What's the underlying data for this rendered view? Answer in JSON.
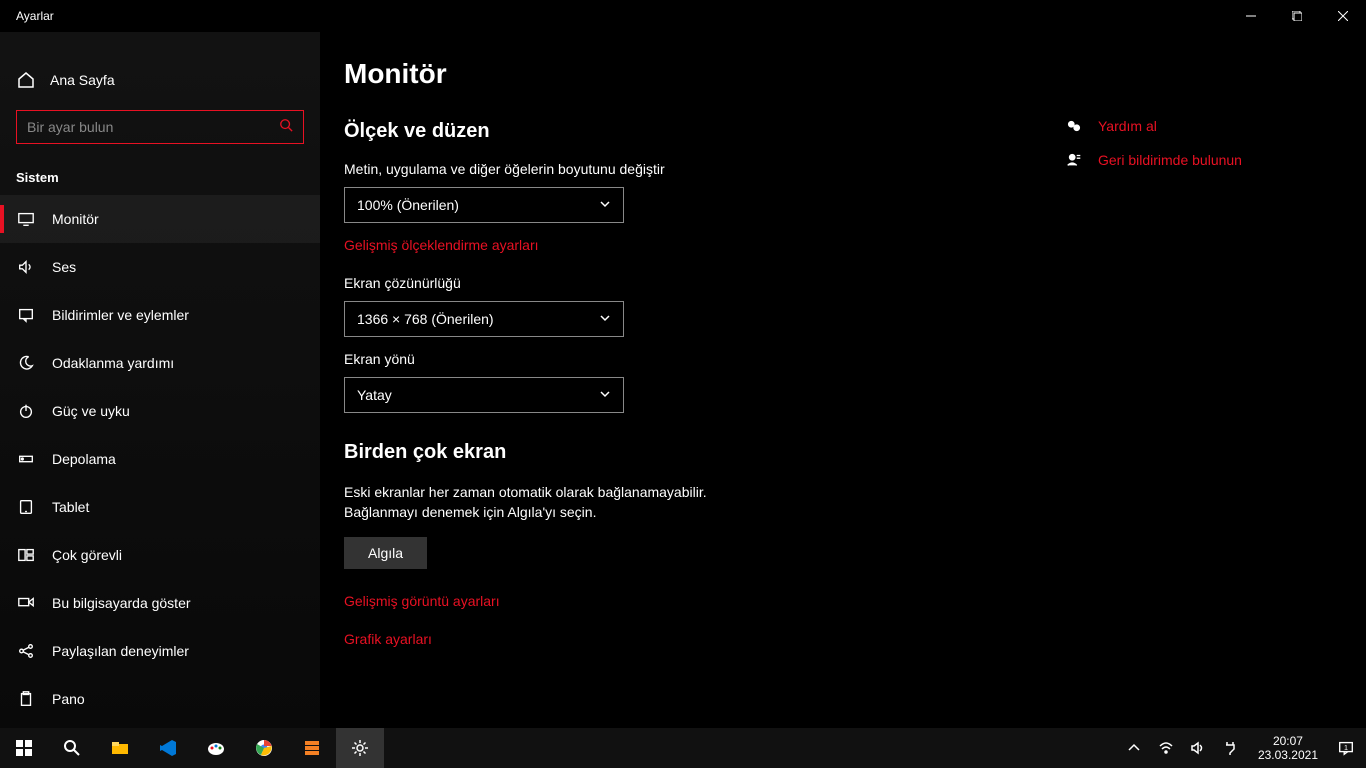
{
  "window": {
    "title": "Ayarlar"
  },
  "sidebar": {
    "home": "Ana Sayfa",
    "search_placeholder": "Bir ayar bulun",
    "category": "Sistem",
    "items": [
      {
        "label": "Monitör",
        "icon": "monitor"
      },
      {
        "label": "Ses",
        "icon": "sound"
      },
      {
        "label": "Bildirimler ve eylemler",
        "icon": "notification"
      },
      {
        "label": "Odaklanma yardımı",
        "icon": "moon"
      },
      {
        "label": "Güç ve uyku",
        "icon": "power"
      },
      {
        "label": "Depolama",
        "icon": "storage"
      },
      {
        "label": "Tablet",
        "icon": "tablet"
      },
      {
        "label": "Çok görevli",
        "icon": "multitask"
      },
      {
        "label": "Bu bilgisayarda göster",
        "icon": "project"
      },
      {
        "label": "Paylaşılan deneyimler",
        "icon": "share"
      },
      {
        "label": "Pano",
        "icon": "clipboard"
      }
    ]
  },
  "main": {
    "page_title": "Monitör",
    "section_scale": "Ölçek ve düzen",
    "scale_label": "Metin, uygulama ve diğer öğelerin boyutunu değiştir",
    "scale_value": "100% (Önerilen)",
    "advanced_scaling_link": "Gelişmiş ölçeklendirme ayarları",
    "resolution_label": "Ekran çözünürlüğü",
    "resolution_value": "1366 × 768 (Önerilen)",
    "orientation_label": "Ekran yönü",
    "orientation_value": "Yatay",
    "section_multi": "Birden çok ekran",
    "multi_paragraph": "Eski ekranlar her zaman otomatik olarak bağlanamayabilir. Bağlanmayı denemek için Algıla'yı seçin.",
    "detect_button": "Algıla",
    "advanced_display_link": "Gelişmiş görüntü ayarları",
    "graphics_link": "Grafik ayarları"
  },
  "right": {
    "help": "Yardım al",
    "feedback": "Geri bildirimde bulunun"
  },
  "taskbar": {
    "time": "20:07",
    "date": "23.03.2021",
    "notif_count": "1"
  }
}
